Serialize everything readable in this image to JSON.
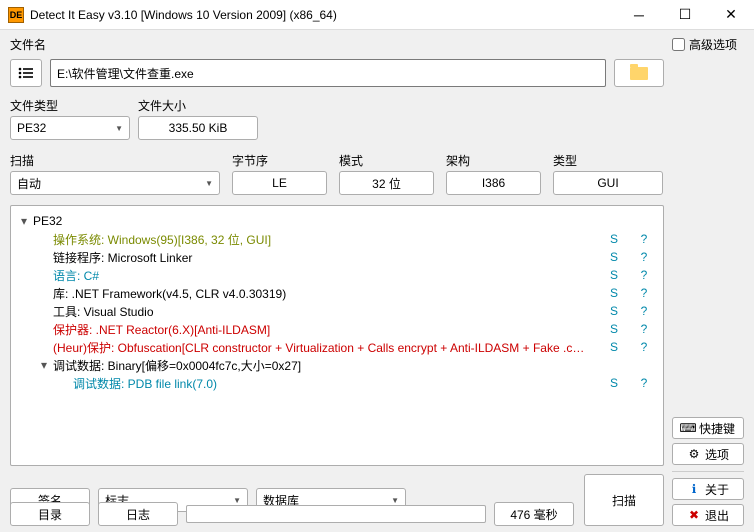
{
  "window": {
    "title": "Detect It Easy v3.10 [Windows 10 Version 2009] (x86_64)",
    "icon_text": "DE"
  },
  "filename": {
    "label": "文件名",
    "value": "E:\\软件管理\\文件查重.exe"
  },
  "filetype": {
    "label": "文件类型",
    "value": "PE32"
  },
  "filesize": {
    "label": "文件大小",
    "value": "335.50 KiB"
  },
  "advanced": {
    "label": "高级选项"
  },
  "scan_row": {
    "scan_label": "扫描",
    "scan_mode": "自动",
    "endian_label": "字节序",
    "endian_value": "LE",
    "mode_label": "模式",
    "mode_value": "32 位",
    "arch_label": "架构",
    "arch_value": "I386",
    "type_label": "类型",
    "type_value": "GUI"
  },
  "results": {
    "root": "PE32",
    "rows": [
      {
        "color": "#7a8a00",
        "text": "操作系统: Windows(95)[I386, 32 位, GUI]",
        "s": "S",
        "q": "?"
      },
      {
        "color": "#000000",
        "text": "链接程序: Microsoft Linker",
        "s": "S",
        "q": "?"
      },
      {
        "color": "#0088aa",
        "text": "语言: C#",
        "s": "S",
        "q": "?"
      },
      {
        "color": "#000000",
        "text": "库: .NET Framework(v4.5, CLR v4.0.30319)",
        "s": "S",
        "q": "?"
      },
      {
        "color": "#000000",
        "text": "工具: Visual Studio",
        "s": "S",
        "q": "?"
      },
      {
        "color": "#cc0000",
        "text": "保护器: .NET Reactor(6.X)[Anti-ILDASM]",
        "s": "S",
        "q": "?"
      },
      {
        "color": "#cc0000",
        "text": "(Heur)保护: Obfuscation[CLR constructor + Virtualization + Calls encrypt + Anti-ILDASM + Fake .c…",
        "s": "S",
        "q": "?"
      }
    ],
    "debug_parent": "调试数据: Binary[偏移=0x0004fc7c,大小=0x27]",
    "debug_child": {
      "color": "#0088aa",
      "text": "调试数据: PDB file link(7.0)",
      "s": "S",
      "q": "?"
    }
  },
  "bottom": {
    "signatures": "签名",
    "flags": "标志",
    "database": "数据库",
    "directory": "目录",
    "log": "日志",
    "time": "476 毫秒",
    "scan": "扫描"
  },
  "side": {
    "shortcuts": "快捷键",
    "options": "选项",
    "about": "关于",
    "exit": "退出"
  }
}
